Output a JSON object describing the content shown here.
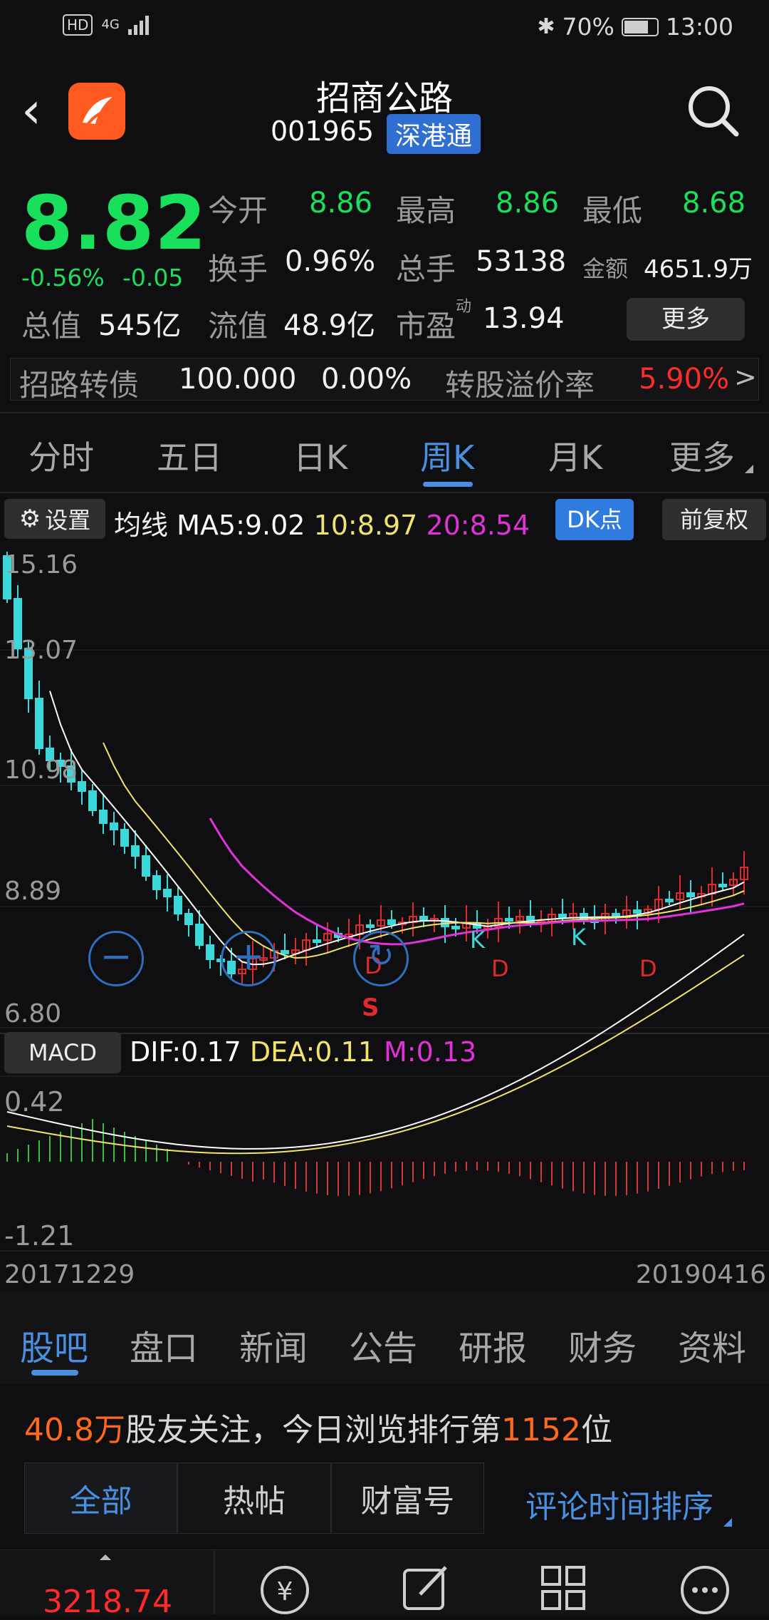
{
  "status": {
    "network": "4G",
    "hd": "HD",
    "battery": "70%",
    "time": "13:00"
  },
  "header": {
    "title": "招商公路",
    "code": "001965",
    "badge": "深港通"
  },
  "quote": {
    "price": "8.82",
    "change_pct": "-0.56%",
    "change": "-0.05",
    "open_label": "今开",
    "open": "8.86",
    "high_label": "最高",
    "high": "8.86",
    "low_label": "最低",
    "low": "8.68",
    "turnover_label": "换手",
    "turnover": "0.96%",
    "volume_label": "总手",
    "volume": "53138",
    "amount_label": "金额",
    "amount": "4651.9万",
    "mktcap_label": "总值",
    "mktcap": "545亿",
    "float_label": "流值",
    "float": "48.9亿",
    "pe_label": "市盈",
    "pe_sup": "动",
    "pe": "13.94",
    "more": "更多"
  },
  "bond": {
    "name": "招路转债",
    "price": "100.000",
    "pct": "0.00%",
    "premium_label": "转股溢价率",
    "premium": "5.90%",
    "arrow": ">"
  },
  "tabs": [
    "分时",
    "五日",
    "日K",
    "周K",
    "月K",
    "更多"
  ],
  "ma": {
    "settings": "设置",
    "label": "均线",
    "ma5": "MA5:9.02",
    "ma10": "10:8.97",
    "ma20": "20:8.54",
    "dk": "DK点",
    "adjust": "前复权"
  },
  "macd": {
    "label": "MACD",
    "dif": "DIF:0.17",
    "dea": "DEA:0.11",
    "m": "M:0.13"
  },
  "chart_data": {
    "type": "candlestick",
    "price_axis": [
      "15.16",
      "13.07",
      "10.98",
      "8.89",
      "6.80"
    ],
    "macd_axis": [
      "0.42",
      "-1.21"
    ],
    "date_start": "20171229",
    "date_end": "20190416",
    "markers": [
      "S",
      "D",
      "K",
      "D",
      "K",
      "D"
    ],
    "colors": {
      "up": "#e02a2a",
      "down": "#3ad8d8",
      "ma5": "#ffffff",
      "ma10": "#f3e36a",
      "ma20": "#e032d8"
    }
  },
  "bottom_tabs": [
    "股吧",
    "盘口",
    "新闻",
    "公告",
    "研报",
    "财务",
    "资料"
  ],
  "community": {
    "fans": "40.8万",
    "text1": "股友关注，今日浏览排行第",
    "rank": "1152",
    "text2": "位"
  },
  "filters": [
    "全部",
    "热帖",
    "财富号"
  ],
  "sort": "评论时间排序",
  "index_value": "3218.74"
}
